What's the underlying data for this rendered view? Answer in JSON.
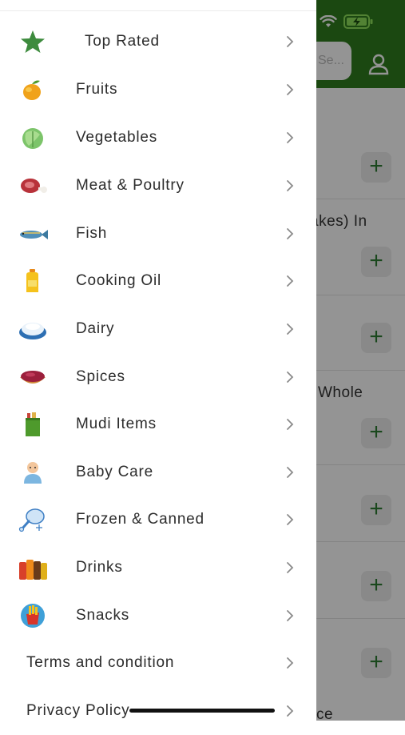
{
  "background": {
    "search_placeholder": "Se...",
    "items": [
      {
        "title": ""
      },
      {
        "title": "akes) In"
      },
      {
        "title": ""
      },
      {
        "title": "Whole"
      },
      {
        "title": ""
      },
      {
        "title": ""
      },
      {
        "title": ""
      },
      {
        "title": "ce"
      }
    ],
    "add_label": "+"
  },
  "menu": {
    "items": [
      {
        "label": "Top Rated",
        "icon": "star-icon"
      },
      {
        "label": "Fruits",
        "icon": "mango-icon"
      },
      {
        "label": "Vegetables",
        "icon": "cabbage-icon"
      },
      {
        "label": "Meat & Poultry",
        "icon": "meat-icon"
      },
      {
        "label": "Fish",
        "icon": "fish-icon"
      },
      {
        "label": "Cooking Oil",
        "icon": "oil-bottle-icon"
      },
      {
        "label": "Dairy",
        "icon": "dairy-icon"
      },
      {
        "label": "Spices",
        "icon": "spices-bowl-icon"
      },
      {
        "label": "Mudi Items",
        "icon": "grocery-bag-icon"
      },
      {
        "label": "Baby Care",
        "icon": "baby-icon"
      },
      {
        "label": "Frozen & Canned",
        "icon": "frozen-chicken-icon"
      },
      {
        "label": "Drinks",
        "icon": "bottles-icon"
      },
      {
        "label": "Snacks",
        "icon": "fries-icon"
      }
    ],
    "links": [
      {
        "label": "Terms and condition"
      },
      {
        "label": "Privacy Policy"
      }
    ]
  },
  "colors": {
    "brand_green": "#2f7d1e",
    "star_green": "#3d8b3d",
    "plus_green": "#2e7d32"
  }
}
